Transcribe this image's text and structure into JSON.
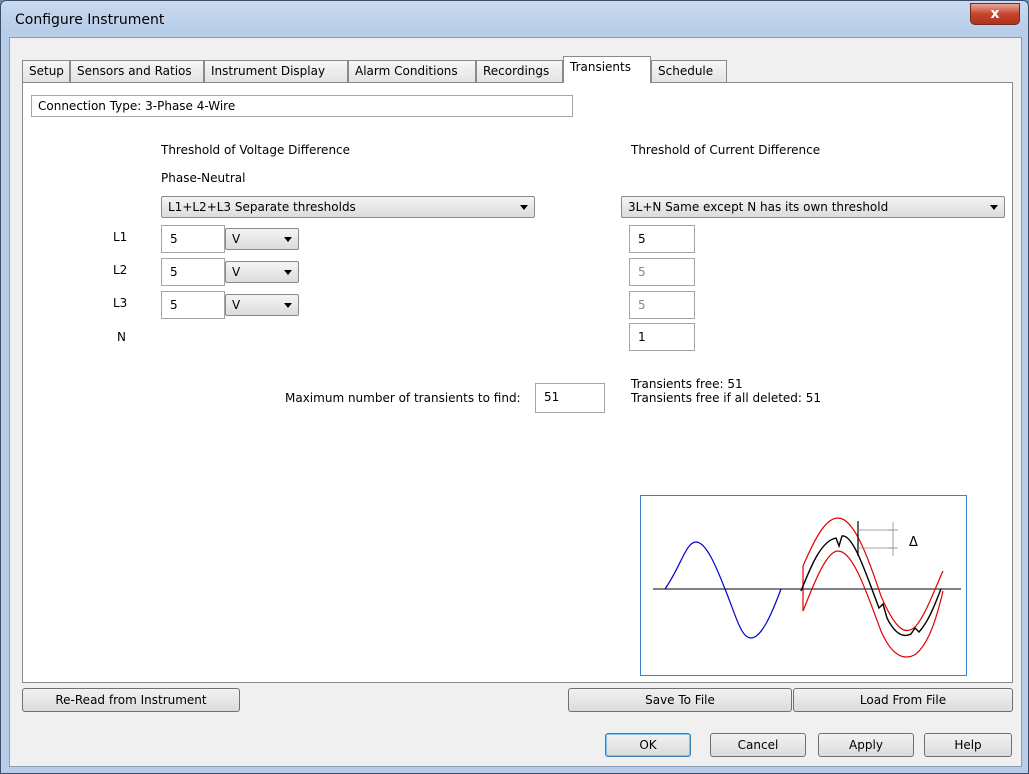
{
  "window": {
    "title": "Configure Instrument",
    "close_glyph": "x"
  },
  "tabs": [
    {
      "label": "Setup",
      "active": false
    },
    {
      "label": "Sensors and Ratios",
      "active": false
    },
    {
      "label": "Instrument Display",
      "active": false
    },
    {
      "label": "Alarm Conditions",
      "active": false
    },
    {
      "label": "Recordings",
      "active": false
    },
    {
      "label": "Transients",
      "active": true
    },
    {
      "label": "Schedule",
      "active": false
    }
  ],
  "connection_type": "Connection Type: 3-Phase 4-Wire",
  "voltage": {
    "title": "Threshold of Voltage Difference",
    "subtitle": "Phase-Neutral",
    "mode": "L1+L2+L3 Separate thresholds",
    "rows": [
      {
        "label": "L1",
        "value": "5",
        "unit": "V"
      },
      {
        "label": "L2",
        "value": "5",
        "unit": "V"
      },
      {
        "label": "L3",
        "value": "5",
        "unit": "V"
      },
      {
        "label": "N"
      }
    ]
  },
  "current": {
    "title": "Threshold of Current Difference",
    "mode": "3L+N Same except N has its own threshold",
    "values": [
      "5",
      "5",
      "5",
      "1"
    ]
  },
  "max_transients": {
    "label": "Maximum number of transients to find:",
    "value": "51"
  },
  "transients_free": "Transients free: 51",
  "transients_free_deleted": "Transients free if all deleted: 51",
  "diagram": {
    "delta_symbol": "Δ"
  },
  "buttons": {
    "reread": "Re-Read from Instrument",
    "save": "Save To File",
    "load": "Load From File",
    "ok": "OK",
    "cancel": "Cancel",
    "apply": "Apply",
    "help": "Help"
  },
  "colors": {
    "signal": "#0000cc",
    "envelope": "#e00000",
    "measured": "#000000",
    "graph_border": "#3a7fd0"
  }
}
